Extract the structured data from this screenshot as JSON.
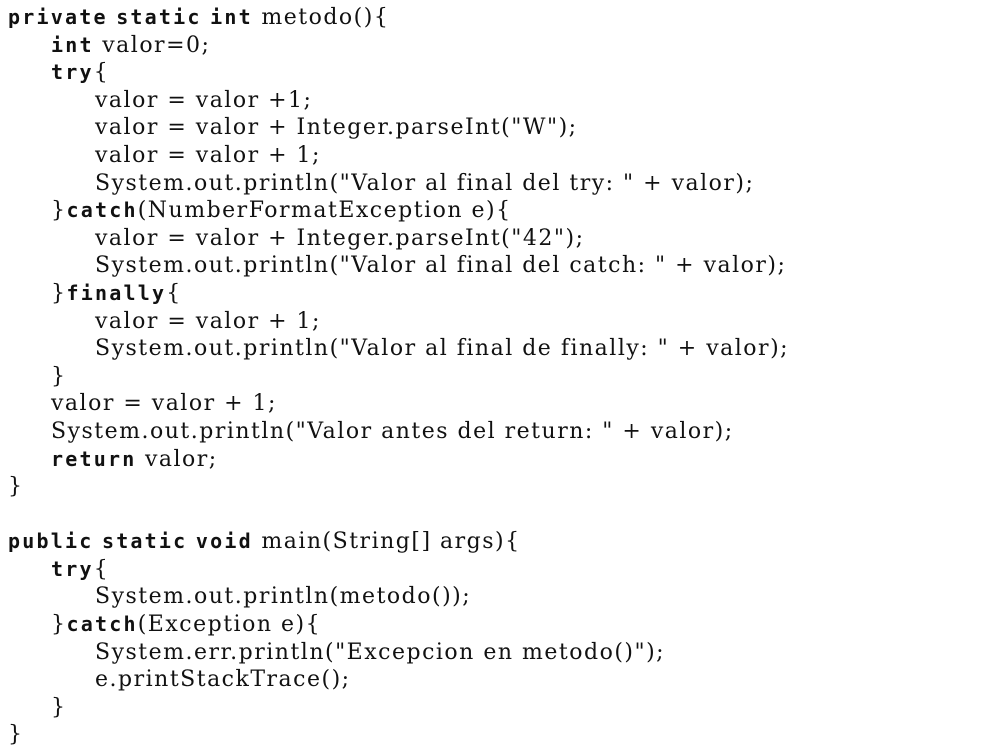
{
  "code": {
    "l1": {
      "k1": "private",
      "k2": "static",
      "k3": "int",
      "t": "metodo(){"
    },
    "l2": {
      "k": "int",
      "t": "valor=0;"
    },
    "l3": {
      "k": "try",
      "t": "{"
    },
    "l4": "valor = valor +1;",
    "l5": "valor = valor + Integer.parseInt(\"W\");",
    "l6": "valor = valor + 1;",
    "l7": "System.out.println(\"Valor al final del try: \" + valor);",
    "l8": {
      "t1": "}",
      "k": "catch",
      "t2": "(NumberFormatException e){"
    },
    "l9": "valor = valor + Integer.parseInt(\"42\");",
    "l10": "System.out.println(\"Valor al final del catch: \" + valor);",
    "l11": {
      "t1": "}",
      "k": "finally",
      "t2": "{"
    },
    "l12": "valor = valor + 1;",
    "l13": "System.out.println(\"Valor al final de finally: \" + valor);",
    "l14": "}",
    "l15": "valor = valor + 1;",
    "l16": "System.out.println(\"Valor antes del return: \" + valor);",
    "l17": {
      "k": "return",
      "t": "valor;"
    },
    "l18": "}",
    "l20": {
      "k1": "public",
      "k2": "static",
      "k3": "void",
      "t": "main(String[] args){"
    },
    "l21": {
      "k": "try",
      "t": "{"
    },
    "l22": "System.out.println(metodo());",
    "l23": {
      "t1": "}",
      "k": "catch",
      "t2": "(Exception e){"
    },
    "l24": "System.err.println(\"Excepcion en metodo()\");",
    "l25": "e.printStackTrace();",
    "l26": "}",
    "l27": "}"
  }
}
